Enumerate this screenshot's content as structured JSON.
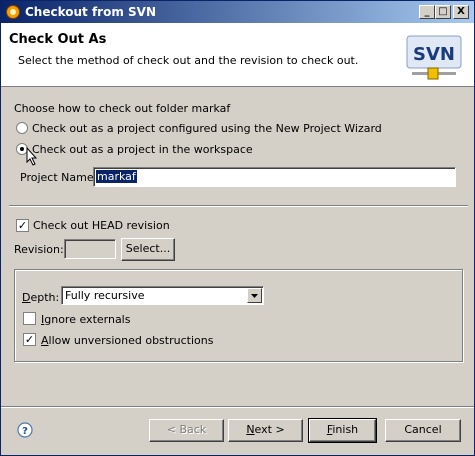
{
  "window": {
    "title": "Checkout from SVN",
    "controls": {
      "minimize": "_",
      "maximize": "□",
      "close": "X"
    }
  },
  "header": {
    "title": "Check Out As",
    "description": "Select the method of check out and the revision to check out.",
    "logo_text": "SVN"
  },
  "method": {
    "prompt": "Choose how to check out folder markaf",
    "options": [
      {
        "label": "Check out as a project configured using the New Project Wizard",
        "checked": false
      },
      {
        "label": "Check out as a project in the workspace",
        "checked": true
      }
    ],
    "project_name_label": "Project Name:",
    "project_name_value": "markaf"
  },
  "revision": {
    "head_label": "Check out HEAD revision",
    "head_checked": true,
    "revision_label": "Revision:",
    "revision_value": "",
    "select_button": "Select..."
  },
  "options_group": {
    "depth_label": "Depth:",
    "depth_value": "Fully recursive",
    "ignore_externals_label": "Ignore externals",
    "ignore_externals_checked": false,
    "allow_unversioned_label": "Allow unversioned obstructions",
    "allow_unversioned_checked": true
  },
  "footer": {
    "back": "< Back",
    "next": "Next >",
    "finish": "Finish",
    "cancel": "Cancel"
  },
  "icons": {
    "app": "svn-checkout-icon",
    "help": "help-icon",
    "dropdown": "chevron-down-icon"
  }
}
